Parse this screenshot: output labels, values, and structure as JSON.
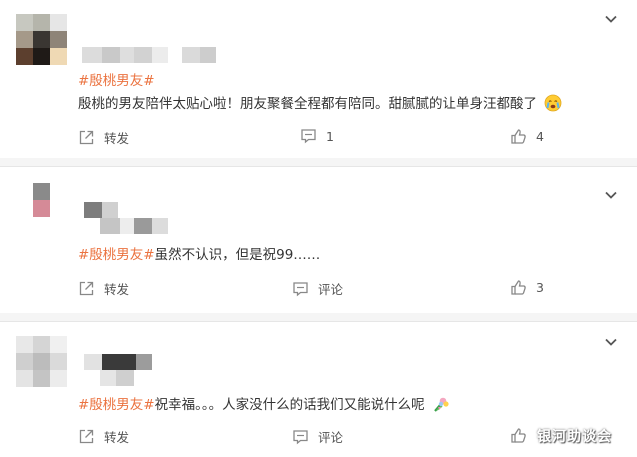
{
  "comments": [
    {
      "hashtag": "#殷桃男友#",
      "text": "殷桃的男友陪伴太贴心啦！朋友聚餐全程都有陪同。甜腻腻的让单身汪都酸了",
      "emoji": "crying-face-emoji",
      "repost_label": "转发",
      "comment_label": "1",
      "like_count": "4"
    },
    {
      "hashtag": "#殷桃男友#",
      "text": "虽然不认识，但是祝99……",
      "repost_label": "转发",
      "comment_label": "评论",
      "like_count": "3"
    },
    {
      "hashtag": "#殷桃男友#",
      "text": "祝幸福。。。人家没什么的话我们又能说什么呢",
      "emoji": "bouquet-emoji",
      "repost_label": "转发",
      "comment_label": "评论",
      "like_count": ""
    }
  ],
  "watermark": "银河助谈会",
  "colors": {
    "hashtag": "#eb7340",
    "text": "#333333",
    "icon": "#888888",
    "divider": "#e6e6e6"
  }
}
